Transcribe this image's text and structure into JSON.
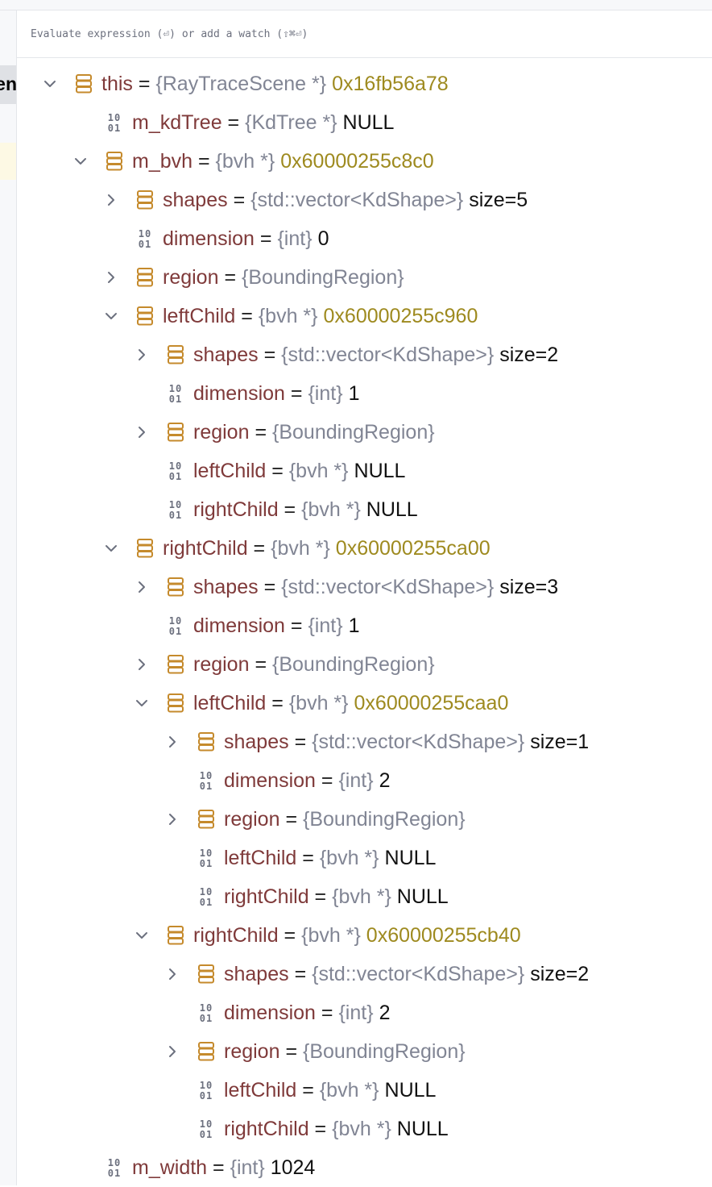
{
  "evaluate": {
    "placeholder": "Evaluate expression (⏎) or add a watch (⇧⌘⏎)"
  },
  "gutter": {
    "tab_fragment": "en"
  },
  "colors": {
    "name": "#7f3a3a",
    "type": "#818594",
    "address": "#9e8a1f",
    "value": "#111111",
    "struct_icon": "#c58a2c"
  },
  "rows": [
    {
      "depth": 0,
      "expander": "expanded",
      "icon": "struct-icon",
      "name": "this",
      "type": "{RayTraceScene *}",
      "value": "0x16fb56a78",
      "value_style": "address"
    },
    {
      "depth": 1,
      "expander": "none",
      "icon": "binary-icon",
      "name": "m_kdTree",
      "type": "{KdTree *}",
      "value": "NULL",
      "value_style": "plain"
    },
    {
      "depth": 1,
      "expander": "expanded",
      "icon": "struct-icon",
      "name": "m_bvh",
      "type": "{bvh *}",
      "value": "0x60000255c8c0",
      "value_style": "address"
    },
    {
      "depth": 2,
      "expander": "collapsed",
      "icon": "struct-icon",
      "name": "shapes",
      "type": "{std::vector<KdShape>}",
      "value": "size=5",
      "value_style": "plain"
    },
    {
      "depth": 2,
      "expander": "none",
      "icon": "binary-icon",
      "name": "dimension",
      "type": "{int}",
      "value": "0",
      "value_style": "plain"
    },
    {
      "depth": 2,
      "expander": "collapsed",
      "icon": "struct-icon",
      "name": "region",
      "type": "{BoundingRegion}",
      "value": "",
      "value_style": "plain"
    },
    {
      "depth": 2,
      "expander": "expanded",
      "icon": "struct-icon",
      "name": "leftChild",
      "type": "{bvh *}",
      "value": "0x60000255c960",
      "value_style": "address"
    },
    {
      "depth": 3,
      "expander": "collapsed",
      "icon": "struct-icon",
      "name": "shapes",
      "type": "{std::vector<KdShape>}",
      "value": "size=2",
      "value_style": "plain"
    },
    {
      "depth": 3,
      "expander": "none",
      "icon": "binary-icon",
      "name": "dimension",
      "type": "{int}",
      "value": "1",
      "value_style": "plain"
    },
    {
      "depth": 3,
      "expander": "collapsed",
      "icon": "struct-icon",
      "name": "region",
      "type": "{BoundingRegion}",
      "value": "",
      "value_style": "plain"
    },
    {
      "depth": 3,
      "expander": "none",
      "icon": "binary-icon",
      "name": "leftChild",
      "type": "{bvh *}",
      "value": "NULL",
      "value_style": "plain"
    },
    {
      "depth": 3,
      "expander": "none",
      "icon": "binary-icon",
      "name": "rightChild",
      "type": "{bvh *}",
      "value": "NULL",
      "value_style": "plain"
    },
    {
      "depth": 2,
      "expander": "expanded",
      "icon": "struct-icon",
      "name": "rightChild",
      "type": "{bvh *}",
      "value": "0x60000255ca00",
      "value_style": "address"
    },
    {
      "depth": 3,
      "expander": "collapsed",
      "icon": "struct-icon",
      "name": "shapes",
      "type": "{std::vector<KdShape>}",
      "value": "size=3",
      "value_style": "plain"
    },
    {
      "depth": 3,
      "expander": "none",
      "icon": "binary-icon",
      "name": "dimension",
      "type": "{int}",
      "value": "1",
      "value_style": "plain"
    },
    {
      "depth": 3,
      "expander": "collapsed",
      "icon": "struct-icon",
      "name": "region",
      "type": "{BoundingRegion}",
      "value": "",
      "value_style": "plain"
    },
    {
      "depth": 3,
      "expander": "expanded",
      "icon": "struct-icon",
      "name": "leftChild",
      "type": "{bvh *}",
      "value": "0x60000255caa0",
      "value_style": "address"
    },
    {
      "depth": 4,
      "expander": "collapsed",
      "icon": "struct-icon",
      "name": "shapes",
      "type": "{std::vector<KdShape>}",
      "value": "size=1",
      "value_style": "plain"
    },
    {
      "depth": 4,
      "expander": "none",
      "icon": "binary-icon",
      "name": "dimension",
      "type": "{int}",
      "value": "2",
      "value_style": "plain"
    },
    {
      "depth": 4,
      "expander": "collapsed",
      "icon": "struct-icon",
      "name": "region",
      "type": "{BoundingRegion}",
      "value": "",
      "value_style": "plain"
    },
    {
      "depth": 4,
      "expander": "none",
      "icon": "binary-icon",
      "name": "leftChild",
      "type": "{bvh *}",
      "value": "NULL",
      "value_style": "plain"
    },
    {
      "depth": 4,
      "expander": "none",
      "icon": "binary-icon",
      "name": "rightChild",
      "type": "{bvh *}",
      "value": "NULL",
      "value_style": "plain"
    },
    {
      "depth": 3,
      "expander": "expanded",
      "icon": "struct-icon",
      "name": "rightChild",
      "type": "{bvh *}",
      "value": "0x60000255cb40",
      "value_style": "address"
    },
    {
      "depth": 4,
      "expander": "collapsed",
      "icon": "struct-icon",
      "name": "shapes",
      "type": "{std::vector<KdShape>}",
      "value": "size=2",
      "value_style": "plain"
    },
    {
      "depth": 4,
      "expander": "none",
      "icon": "binary-icon",
      "name": "dimension",
      "type": "{int}",
      "value": "2",
      "value_style": "plain"
    },
    {
      "depth": 4,
      "expander": "collapsed",
      "icon": "struct-icon",
      "name": "region",
      "type": "{BoundingRegion}",
      "value": "",
      "value_style": "plain"
    },
    {
      "depth": 4,
      "expander": "none",
      "icon": "binary-icon",
      "name": "leftChild",
      "type": "{bvh *}",
      "value": "NULL",
      "value_style": "plain"
    },
    {
      "depth": 4,
      "expander": "none",
      "icon": "binary-icon",
      "name": "rightChild",
      "type": "{bvh *}",
      "value": "NULL",
      "value_style": "plain"
    },
    {
      "depth": 1,
      "expander": "none",
      "icon": "binary-icon",
      "name": "m_width",
      "type": "{int}",
      "value": "1024",
      "value_style": "plain"
    }
  ]
}
